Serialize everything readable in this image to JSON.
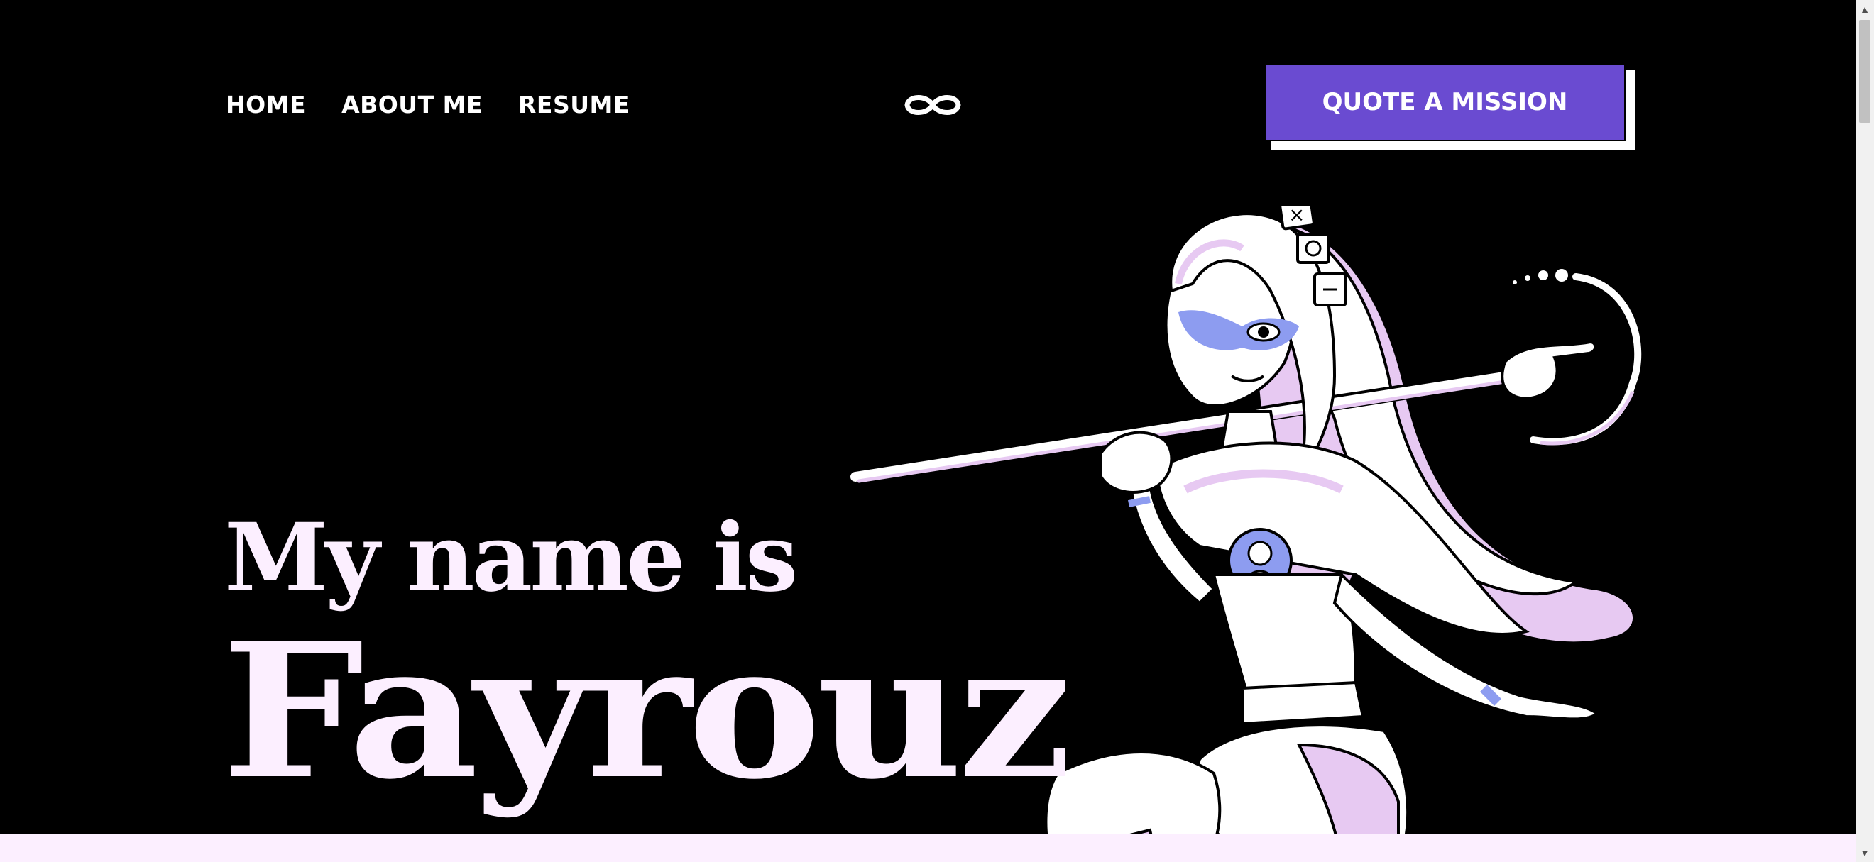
{
  "nav": {
    "items": [
      {
        "label": "HOME"
      },
      {
        "label": "ABOUT ME"
      },
      {
        "label": "RESUME"
      }
    ],
    "logo_icon": "infinity-mask-icon"
  },
  "cta": {
    "label": "QUOTE A MISSION"
  },
  "hero": {
    "line1": "My name is",
    "name": "Fayrouz"
  },
  "colors": {
    "background": "#000000",
    "accent": "#6a4bd1",
    "text_light": "#fcefff",
    "pink_shade": "#e7c9f2",
    "blue_mask": "#8d9cf0"
  },
  "scrollbar": {
    "up_icon": "triangle-up-icon",
    "down_icon": "triangle-down-icon"
  }
}
